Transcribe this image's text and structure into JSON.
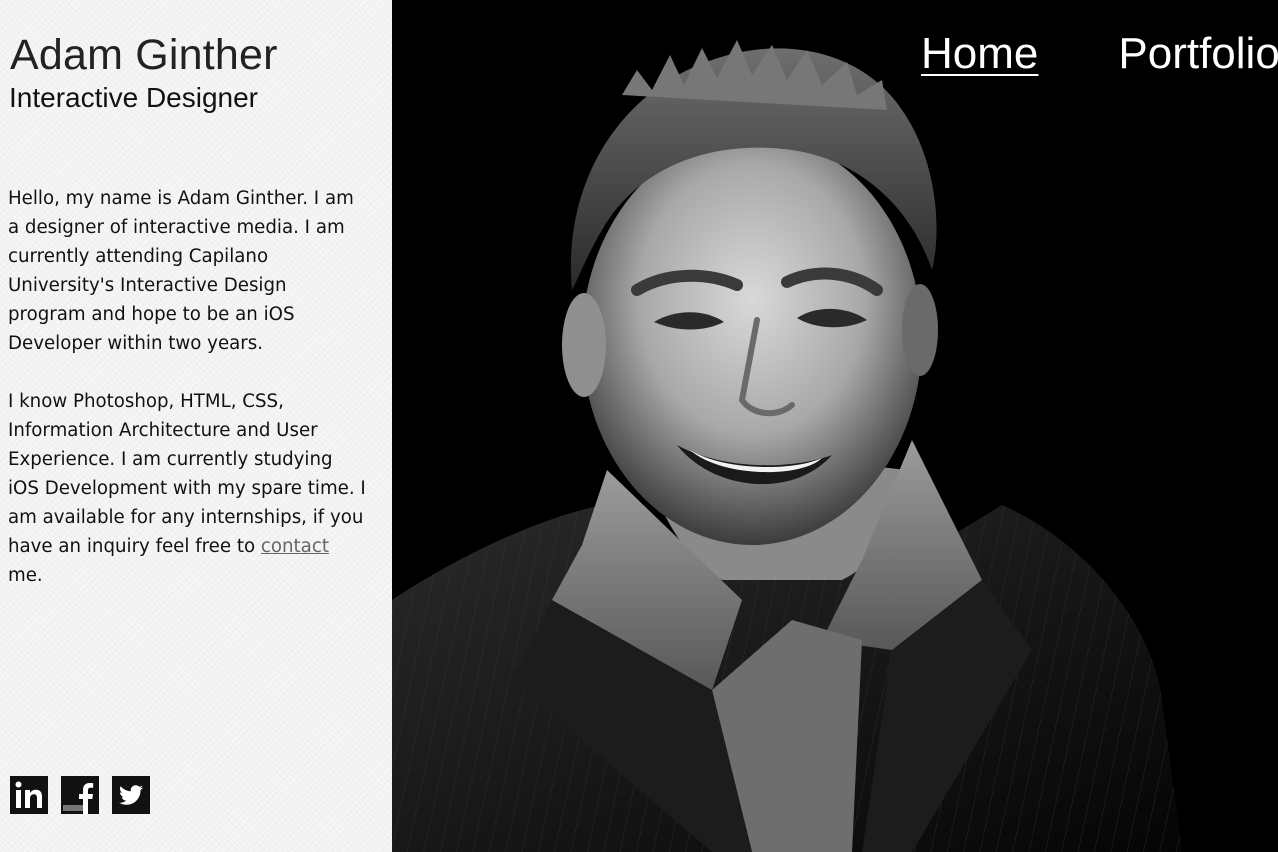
{
  "header": {
    "name": "Adam Ginther",
    "role": "Interactive Designer"
  },
  "bio": {
    "paragraph1": "Hello, my name is Adam Ginther. I am a designer of interactive media. I am currently attending Capilano University's Interactive Design program and hope to be an iOS Developer within two years.",
    "paragraph2_before": "I know Photoshop, HTML, CSS, Information Architecture and User Experience. I am currently studying iOS Development with my spare time. I am available for any internships, if you have an inquiry feel free to ",
    "contact_link": "contact",
    "paragraph2_after": " me."
  },
  "nav": {
    "items": [
      {
        "label": "Home",
        "active": true
      },
      {
        "label": "Portfolio",
        "active": false
      }
    ]
  },
  "social": {
    "icons": [
      "linkedin-icon",
      "facebook-icon",
      "twitter-icon"
    ],
    "linkedin_glyph": "in",
    "facebook_glyph": "f"
  },
  "colors": {
    "sidebar_bg": "#f3f3f3",
    "text": "#111111",
    "link": "#666666",
    "photo_bg": "#000000",
    "nav_text": "#ffffff"
  }
}
